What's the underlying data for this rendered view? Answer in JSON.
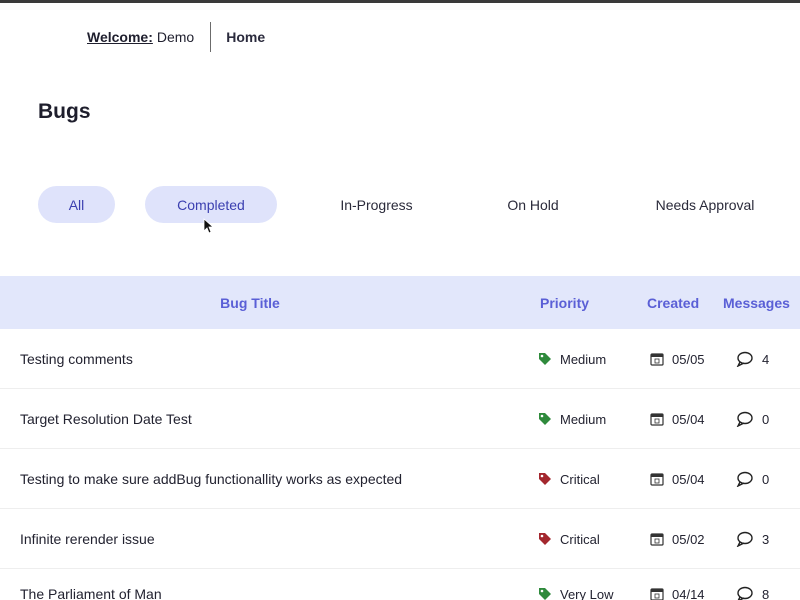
{
  "header": {
    "welcome_label": "Welcome:",
    "username": "Demo",
    "home_label": "Home"
  },
  "page": {
    "title": "Bugs"
  },
  "filters": [
    {
      "label": "All",
      "highlighted": true
    },
    {
      "label": "Completed",
      "highlighted": true
    },
    {
      "label": "In-Progress",
      "highlighted": false
    },
    {
      "label": "On Hold",
      "highlighted": false
    },
    {
      "label": "Needs Approval",
      "highlighted": false
    }
  ],
  "table": {
    "columns": {
      "title": "Bug Title",
      "priority": "Priority",
      "created": "Created",
      "messages": "Messages"
    },
    "rows": [
      {
        "title": "Testing comments",
        "priority": "Medium",
        "created": "05/05",
        "messages": "4"
      },
      {
        "title": "Target Resolution Date Test",
        "priority": "Medium",
        "created": "05/04",
        "messages": "0"
      },
      {
        "title": "Testing to make sure addBug functionallity works as expected",
        "priority": "Critical",
        "created": "05/04",
        "messages": "0"
      },
      {
        "title": "Infinite rerender issue",
        "priority": "Critical",
        "created": "05/02",
        "messages": "3"
      },
      {
        "title": "The Parliament of Man",
        "priority": "Very Low",
        "created": "04/14",
        "messages": "8"
      }
    ]
  },
  "colors": {
    "pill_bg": "#dfe3fb",
    "header_bg": "#e2e7fb",
    "header_text": "#5a5fd6",
    "priority_medium": "#2f8a3c",
    "priority_critical": "#a3272e",
    "priority_very_low": "#2f8a3c"
  },
  "icons": {
    "priority": "tag-icon",
    "created": "calendar-icon",
    "messages": "comment-icon"
  }
}
